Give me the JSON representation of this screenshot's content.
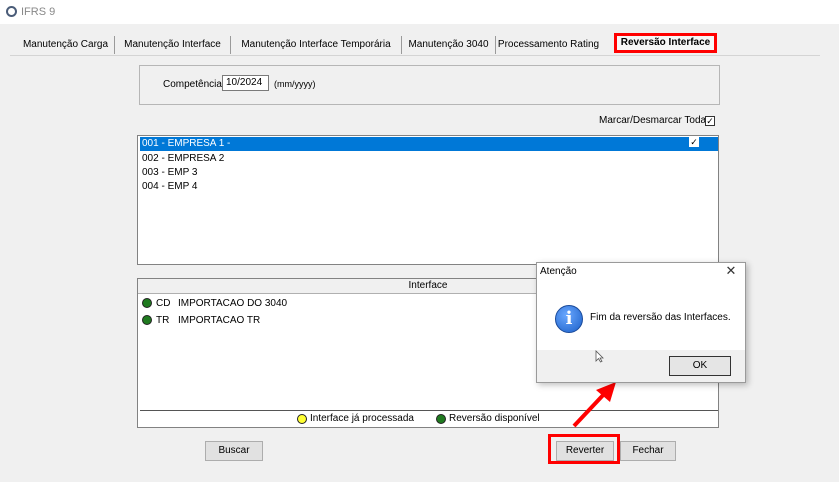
{
  "window": {
    "title": "IFRS 9"
  },
  "tabs": [
    {
      "label": "Manutenção Carga"
    },
    {
      "label": "Manutenção Interface"
    },
    {
      "label": "Manutenção Interface Temporária"
    },
    {
      "label": "Manutenção 3040"
    },
    {
      "label": "Processamento Rating"
    },
    {
      "label": "Reversão Interface",
      "active": true
    }
  ],
  "competencia": {
    "label": "Competência",
    "value": "10/2024",
    "hint": "(mm/yyyy)"
  },
  "mark_all": {
    "label": "Marcar/Desmarcar Todas",
    "checked": true
  },
  "companies": [
    {
      "text": "001 - EMPRESA 1 -",
      "selected": true,
      "checked": true
    },
    {
      "text": "002 - EMPRESA 2"
    },
    {
      "text": "003 - EMP 3"
    },
    {
      "text": "004 - EMP 4"
    }
  ],
  "interface_grid": {
    "header": "Interface",
    "rows": [
      {
        "code": "CD",
        "name": "IMPORTACAO DO 3040",
        "status_color": "#1f7a1f"
      },
      {
        "code": "TR",
        "name": "IMPORTACAO TR",
        "status_color": "#1f7a1f"
      }
    ],
    "legend": [
      {
        "label": "Interface já processada",
        "color": "#ffff33"
      },
      {
        "label": "Reversão disponível",
        "color": "#1f7a1f"
      }
    ]
  },
  "buttons": {
    "buscar": "Buscar",
    "reverter": "Reverter",
    "fechar": "Fechar"
  },
  "dialog": {
    "title": "Atenção",
    "close": "✕",
    "icon": "i",
    "message": "Fim da reversão das Interfaces.",
    "ok": "OK"
  },
  "colors": {
    "highlight": "#ff0000",
    "selection": "#0078d7",
    "status_green": "#1f7a1f",
    "status_yellow": "#ffff33"
  }
}
